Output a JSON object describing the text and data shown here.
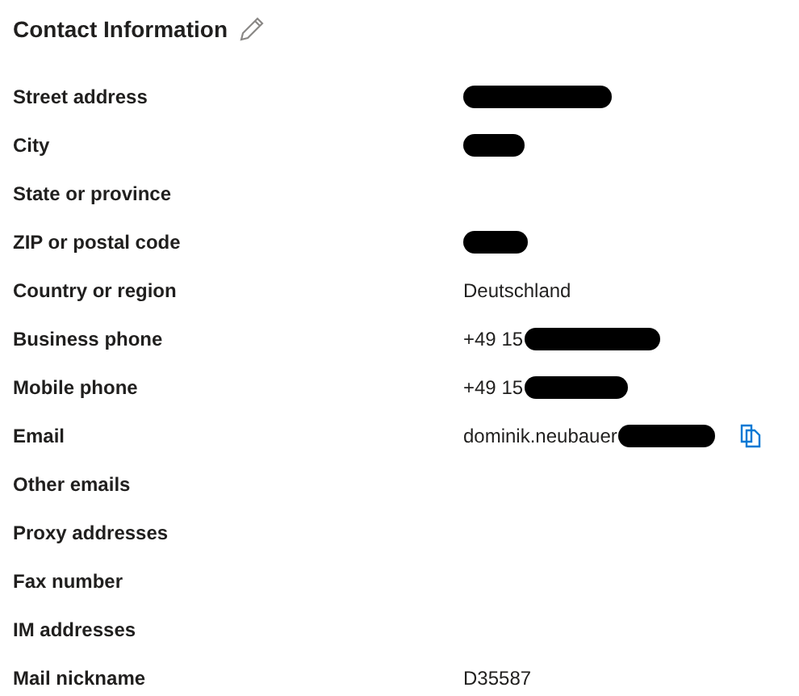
{
  "title": "Contact Information",
  "rows": [
    {
      "label": "Street address",
      "redacted": true
    },
    {
      "label": "City",
      "redacted": true
    },
    {
      "label": "State or province"
    },
    {
      "label": "ZIP or postal code",
      "redacted": true
    },
    {
      "label": "Country or region",
      "value": "Deutschland"
    },
    {
      "label": "Business phone",
      "value": "+49 15",
      "redacted": true
    },
    {
      "label": "Mobile phone",
      "value": "+49 15",
      "redacted": true
    },
    {
      "label": "Email",
      "value": "dominik.neubauer",
      "redacted": true,
      "copyable": true
    },
    {
      "label": "Other emails"
    },
    {
      "label": "Proxy addresses"
    },
    {
      "label": "Fax number"
    },
    {
      "label": "IM addresses"
    },
    {
      "label": "Mail nickname",
      "value": "D35587"
    }
  ]
}
